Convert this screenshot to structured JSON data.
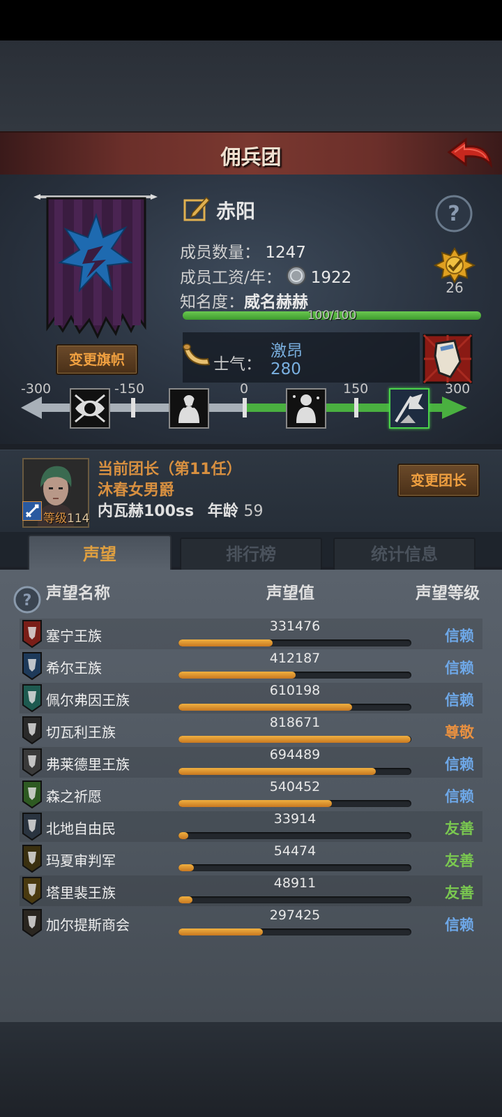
{
  "header": {
    "title": "佣兵团"
  },
  "guild": {
    "name": "赤阳",
    "members_label": "成员数量：",
    "members_value": "1247",
    "wage_label": "成员工资/年：",
    "wage_value": "1922",
    "fame_label": "知名度：",
    "fame_value": "威名赫赫",
    "fame_progress": "100/100",
    "fame_fraction": 1.0,
    "rank_badge": "26",
    "change_banner_button": "变更旗帜",
    "morale_label": "士气：",
    "morale_state": "激昂",
    "morale_value": "280"
  },
  "morale_scale": {
    "ticks": [
      "-300",
      "-150",
      "0",
      "150",
      "300"
    ],
    "value": 280,
    "range": [
      -300,
      300
    ],
    "icons": [
      "paranoid-eye-icon",
      "despair-figure-icon",
      "neutral-figure-icon",
      "rally-banner-icon"
    ],
    "active_icon": 3
  },
  "leader": {
    "title": "当前团长（第11任）",
    "name": "沐春女男爵",
    "level_label": "等级",
    "level_value": "114",
    "weapon": "内瓦赫100ss",
    "age_label": "年龄",
    "age_value": "59",
    "change_button": "变更团长"
  },
  "tabs": [
    {
      "label": "声望",
      "active": true
    },
    {
      "label": "排行榜",
      "active": false
    },
    {
      "label": "统计信息",
      "active": false
    }
  ],
  "reputation": {
    "headers": {
      "name": "声望名称",
      "value": "声望值",
      "level": "声望等级"
    },
    "max": 820000,
    "rows": [
      {
        "name": "塞宁王族",
        "value": "331476",
        "num": 331476,
        "level": "信赖",
        "level_color": "#6ea8e8",
        "crest": "#7a1e18"
      },
      {
        "name": "希尔王族",
        "value": "412187",
        "num": 412187,
        "level": "信赖",
        "level_color": "#6ea8e8",
        "crest": "#1e3a5a"
      },
      {
        "name": "佩尔弗因王族",
        "value": "610198",
        "num": 610198,
        "level": "信赖",
        "level_color": "#6ea8e8",
        "crest": "#1e5a50"
      },
      {
        "name": "切瓦利王族",
        "value": "818671",
        "num": 818671,
        "level": "尊敬",
        "level_color": "#e89040",
        "crest": "#2a2a2a"
      },
      {
        "name": "弗莱德里王族",
        "value": "694489",
        "num": 694489,
        "level": "信赖",
        "level_color": "#6ea8e8",
        "crest": "#3a3a3a"
      },
      {
        "name": "森之祈愿",
        "value": "540452",
        "num": 540452,
        "level": "信赖",
        "level_color": "#6ea8e8",
        "crest": "#2e5a22"
      },
      {
        "name": "北地自由民",
        "value": "33914",
        "num": 33914,
        "level": "友善",
        "level_color": "#7ac850",
        "crest": "#2a3440"
      },
      {
        "name": "玛夏审判军",
        "value": "54474",
        "num": 54474,
        "level": "友善",
        "level_color": "#7ac850",
        "crest": "#3a3010"
      },
      {
        "name": "塔里裴王族",
        "value": "48911",
        "num": 48911,
        "level": "友善",
        "level_color": "#7ac850",
        "crest": "#4a3a10"
      },
      {
        "name": "加尔提斯商会",
        "value": "297425",
        "num": 297425,
        "level": "信赖",
        "level_color": "#6ea8e8",
        "crest": "#2a2620"
      }
    ]
  }
}
